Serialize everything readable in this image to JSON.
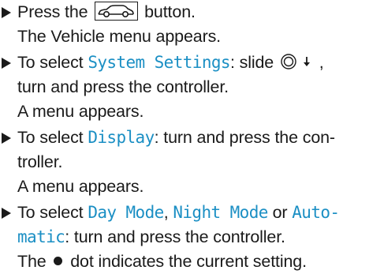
{
  "steps": [
    {
      "line1": {
        "before": "Press the ",
        "after": " button."
      },
      "result": "The Vehicle menu appears.",
      "icon": "car-icon"
    },
    {
      "line1": {
        "before": "To select ",
        "term": "System Settings",
        "after": ": slide ",
        "tail": " ,"
      },
      "line2": "turn and press the controller.",
      "result": "A menu appears.",
      "icons": [
        "controller-icon",
        "down-arrow-icon"
      ]
    },
    {
      "line1": {
        "before": "To select ",
        "term": "Display",
        "after": ": turn and press the con-"
      },
      "line2": "troller.",
      "result": "A menu appears."
    },
    {
      "line1": {
        "before": "To select ",
        "term1": "Day Mode",
        "sep1": ", ",
        "term2": "Night Mode",
        "sep2": " or ",
        "term3": "Auto-"
      },
      "line2": {
        "term3b": "matic",
        "after": ": turn and press the controller."
      },
      "result": {
        "before": "The ",
        "after": " dot indicates the current setting."
      },
      "icon": "dot-icon"
    }
  ],
  "colors": {
    "highlight": "#1b8fc4",
    "text": "#1a1a1a"
  }
}
